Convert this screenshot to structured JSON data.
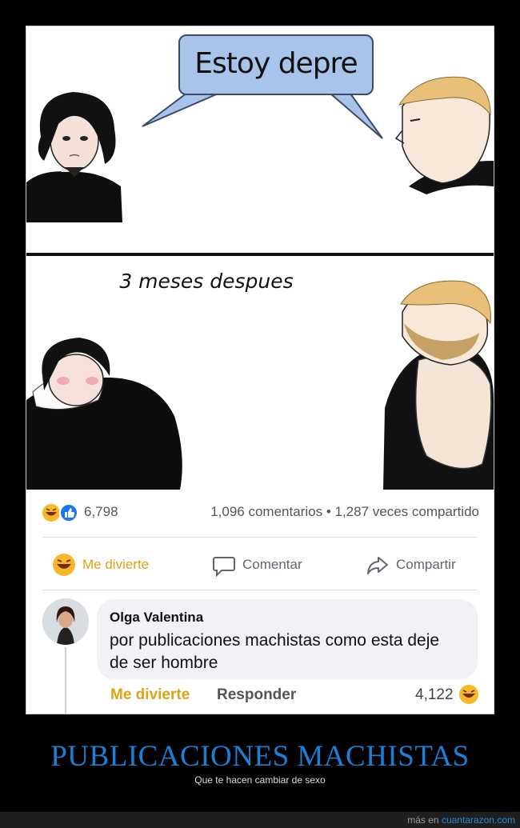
{
  "meme": {
    "bubble_text": "Estoy depre",
    "caption": "3 meses despues"
  },
  "post": {
    "reaction_count": "6,798",
    "comments_count": "1,096 comentarios",
    "dot": "•",
    "shares_count": "1,287 veces compartido",
    "actions": {
      "react_label": "Me divierte",
      "comment_label": "Comentar",
      "share_label": "Compartir"
    },
    "colors": {
      "like_blue": "#1877f2",
      "haha_yellow": "#f7b928",
      "react_active": "#f0a500"
    }
  },
  "comment": {
    "author": "Olga Valentina",
    "text": "por publicaciones machistas como esta deje de ser hombre",
    "react_label": "Me divierte",
    "reply_label": "Responder",
    "reaction_count": "4,122"
  },
  "footer": {
    "headline": "PUBLICACIONES MACHISTAS",
    "subtitle": "Que te hacen cambiar de sexo",
    "credit_prefix": "más en",
    "credit_link": "cuantarazon.com"
  }
}
